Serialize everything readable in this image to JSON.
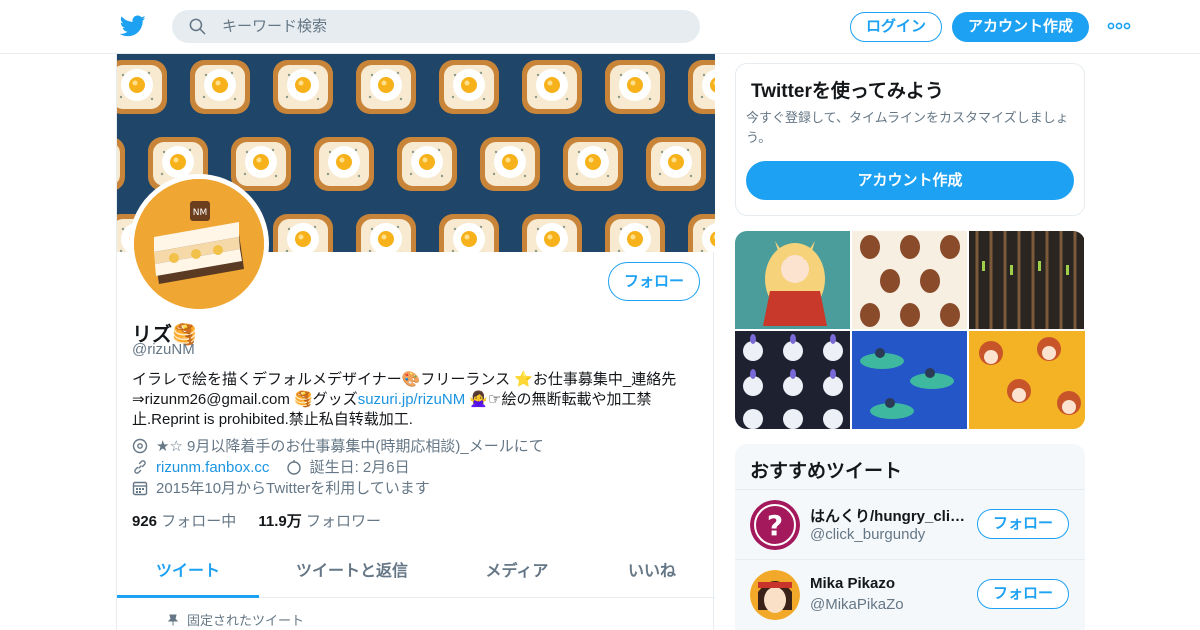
{
  "search": {
    "placeholder": "キーワード検索"
  },
  "header": {
    "login_label": "ログイン",
    "signup_label": "アカウント作成"
  },
  "profile": {
    "name": "リズ🥞",
    "handle": "@rizuNM",
    "follow_label": "フォロー",
    "bio_part1": "イラレで絵を描くデフォルメデザイナー🎨フリーランス ⭐お仕事募集中_連絡先⇒rizunm26@gmail.com 🥞グッズ",
    "bio_link": "suzuri.jp/rizuNM",
    "bio_part2": " 🙅‍♀️☞絵の無断転載や加工禁止.Reprint is prohibited.禁止私自转载加工.",
    "location": "★☆ 9月以降着手のお仕事募集中(時期応相談)_メールにて",
    "website": "rizunm.fanbox.cc",
    "birthday": "誕生日: 2月6日",
    "joined": "2015年10月からTwitterを利用しています",
    "following_count": "926",
    "following_label": "フォロー中",
    "followers_count": "11.9万",
    "followers_label": "フォロワー"
  },
  "tabs": [
    "ツイート",
    "ツイートと返信",
    "メディア",
    "いいね"
  ],
  "pinned_label": "固定されたツイート",
  "signup_card": {
    "title": "Twitterを使ってみよう",
    "desc": "今すぐ登録して、タイムラインをカスタマイズしましょう。",
    "button": "アカウント作成"
  },
  "recommended": {
    "title": "おすすめツイート",
    "users": [
      {
        "name": "はんくり/hungry_clicker",
        "handle": "@click_burgundy",
        "follow": "フォロー"
      },
      {
        "name": "Mika Pikazo",
        "handle": "@MikaPikaZo",
        "follow": "フォロー"
      }
    ]
  },
  "colors": {
    "accent": "#1da1f2",
    "link": "#1b95e0",
    "secondary": "#657786",
    "border": "#e6ecf0"
  },
  "icons": [
    "twitter-bird-icon",
    "search-icon",
    "more-icon",
    "location-icon",
    "link-icon",
    "birthday-icon",
    "calendar-icon",
    "pin-icon"
  ]
}
